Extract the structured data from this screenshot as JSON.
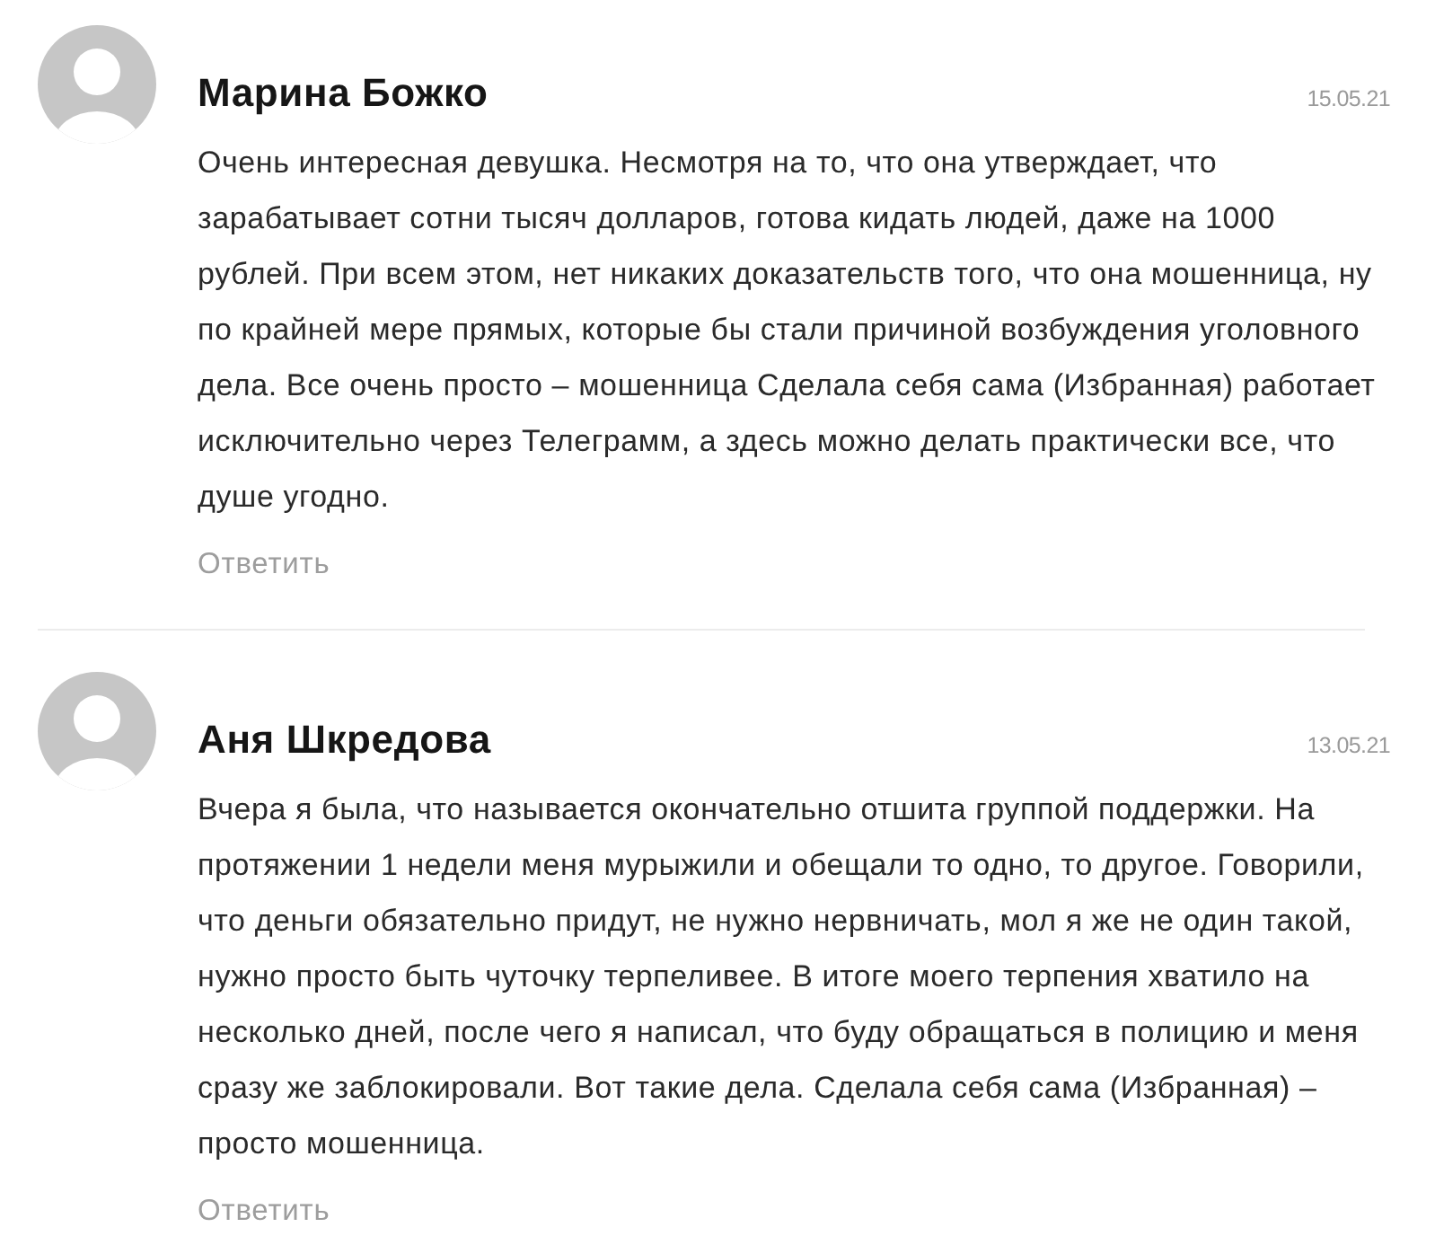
{
  "comments": [
    {
      "author": "Марина Божко",
      "date": "15.05.21",
      "text": "Очень интересная девушка. Несмотря на то, что она утверждает, что зарабатывает сотни тысяч долларов, готова кидать людей, даже на 1000 рублей. При всем этом, нет никаких доказательств того, что она мошенница, ну по крайней мере прямых, которые бы стали причиной возбуждения уголовного дела. Все очень просто – мошенница Сделала себя сама (Избранная) работает исключительно через Телеграмм, а здесь можно делать практически все, что душе угодно.",
      "reply": "Ответить"
    },
    {
      "author": "Аня Шкредова",
      "date": "13.05.21",
      "text": "Вчера я была, что называется окончательно отшита группой поддержки. На протяжении 1 недели меня мурыжили и обещали то одно, то другое. Говорили, что деньги обязательно придут, не нужно нервничать, мол я же не один такой, нужно просто быть чуточку терпеливее. В итоге моего терпения хватило на несколько дней, после чего я написал, что буду обращаться в полицию и меня сразу же заблокировали. Вот такие дела. Сделала себя сама (Избранная) – просто мошенница.",
      "reply": "Ответить"
    }
  ]
}
